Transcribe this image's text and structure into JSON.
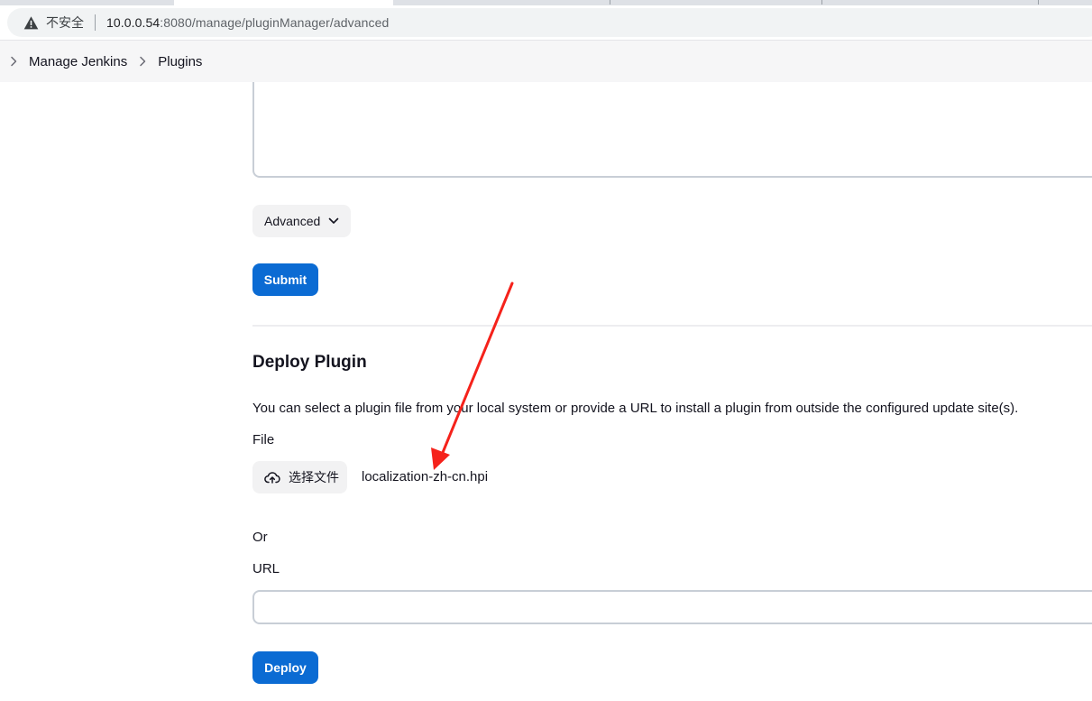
{
  "browser": {
    "security_label": "不安全",
    "url_host": "10.0.0.54",
    "url_rest": ":8080/manage/pluginManager/advanced",
    "icons": {
      "security": "warning-triangle-icon"
    }
  },
  "breadcrumb": {
    "items": [
      {
        "label": "Manage Jenkins"
      },
      {
        "label": "Plugins"
      }
    ],
    "icons": {
      "separator": "chevron-right-icon"
    }
  },
  "update_site": {
    "advanced_label": "Advanced",
    "submit_label": "Submit",
    "icons": {
      "advanced": "chevron-down-icon"
    }
  },
  "deploy_plugin": {
    "title": "Deploy Plugin",
    "description": "You can select a plugin file from your local system or provide a URL to install a plugin from outside the configured update site(s).",
    "file_label": "File",
    "choose_file_label": "选择文件",
    "chosen_file": "localization-zh-cn.hpi",
    "or_label": "Or",
    "url_label": "URL",
    "url_value": "",
    "deploy_label": "Deploy",
    "icons": {
      "choose_file": "cloud-upload-icon"
    }
  },
  "annotation": {
    "arrow_color": "#f5221b"
  },
  "colors": {
    "primary_button": "#0b6bd3",
    "secondary_button": "#f2f2f3",
    "breadcrumb_background": "#f6f6f7",
    "input_border": "#c8ced6"
  }
}
